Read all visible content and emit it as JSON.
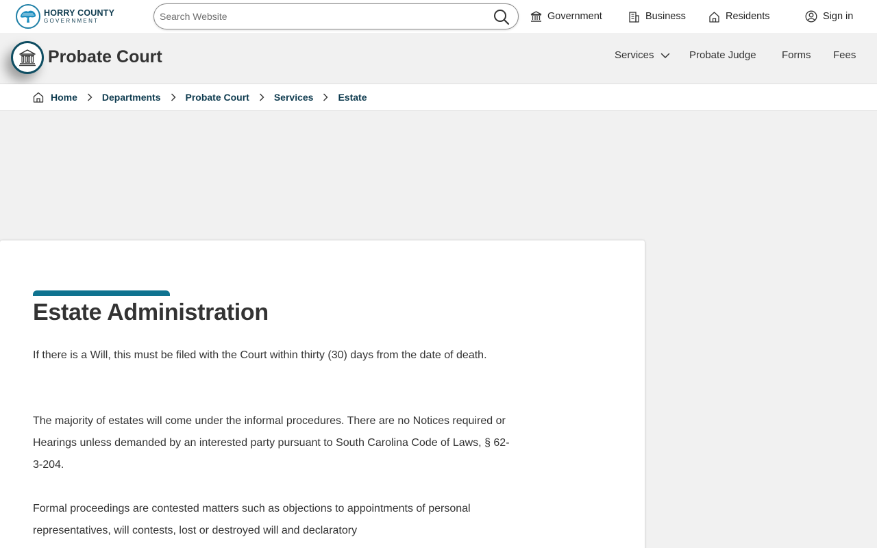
{
  "site": {
    "logo_line1": "HORRY COUNTY",
    "logo_line2": "GOVERNMENT"
  },
  "search": {
    "placeholder": "Search Website"
  },
  "topnav": {
    "government": "Government",
    "business": "Business",
    "residents": "Residents",
    "signin": "Sign in"
  },
  "department": {
    "title": "Probate Court",
    "nav": {
      "services": "Services",
      "probate_judge": "Probate Judge",
      "forms": "Forms",
      "fees": "Fees"
    }
  },
  "breadcrumb": {
    "items": [
      "Home",
      "Departments",
      "Probate Court",
      "Services",
      "Estate"
    ]
  },
  "content": {
    "title": "Estate Administration",
    "paragraphs": [
      "If there is a Will, this must be filed with the Court within thirty (30) days from the date of death.",
      "The majority of estates will come under the informal procedures. There are no Notices required or Hearings unless demanded by an interested party pursuant to South Carolina Code of Laws, § 62-3-204.",
      "Formal proceedings are contested matters such as objections to appointments of personal representatives, will contests, lost or destroyed will and declaratory"
    ]
  },
  "colors": {
    "accent": "#0f7390",
    "dark_teal": "#0e3b4f",
    "background": "#f1f1f1"
  }
}
